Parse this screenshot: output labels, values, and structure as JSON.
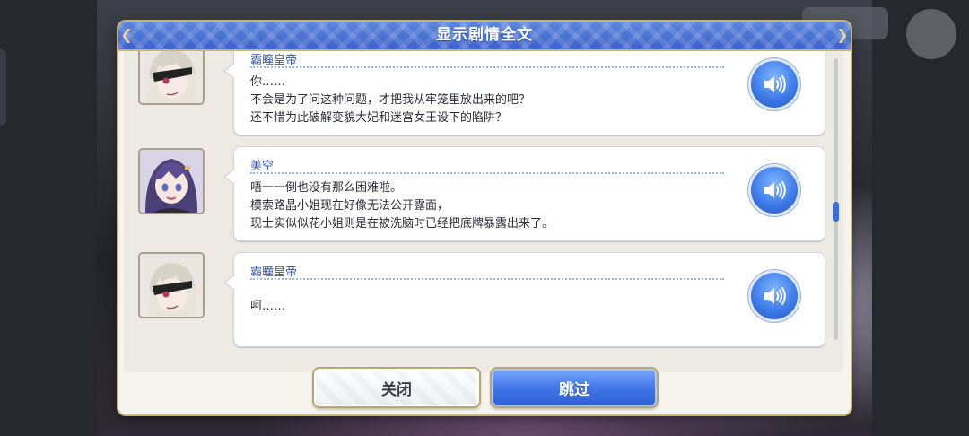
{
  "dialog": {
    "title": "显示剧情全文"
  },
  "entries": [
    {
      "speaker": "霸瞳皇帝",
      "lines": [
        "你……",
        "不会是为了问这种问题，才把我从牢笼里放出来的吧？",
        "还不惜为此破解变貌大妃和迷宫女王设下的陷阱？"
      ],
      "avatar_icon": "portrait-silver-hair-eyepatch",
      "voice_icon": "speaker-icon"
    },
    {
      "speaker": "美空",
      "lines": [
        "唔一一倒也没有那么困难啦。",
        "模索路晶小姐现在好像无法公开露面，",
        "现士实似似花小姐则是在被洗脑时已经把底牌暴露出来了。"
      ],
      "avatar_icon": "portrait-purple-hair",
      "voice_icon": "speaker-icon"
    },
    {
      "speaker": "霸瞳皇帝",
      "lines": [
        "呵……"
      ],
      "avatar_icon": "portrait-silver-hair-eyepatch",
      "voice_icon": "speaker-icon"
    }
  ],
  "footer": {
    "close_label": "关闭",
    "skip_label": "跳过"
  },
  "colors": {
    "header_blue": "#3b63c9",
    "speaker_name": "#3a5aa8",
    "gold_border": "#c8b47a"
  }
}
